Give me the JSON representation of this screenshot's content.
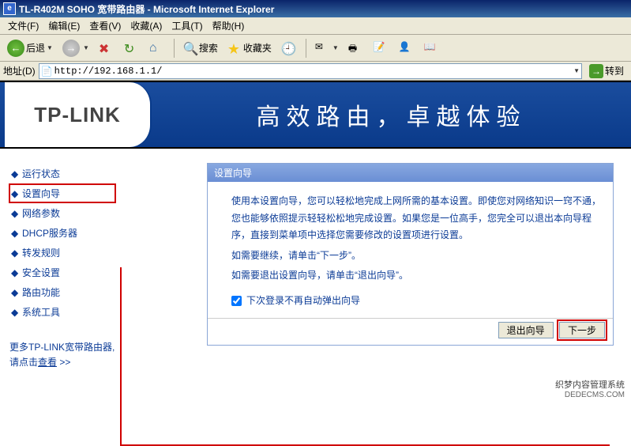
{
  "window": {
    "title": "TL-R402M SOHO 宽带路由器 - Microsoft Internet Explorer"
  },
  "menu": {
    "file": "文件(F)",
    "edit": "编辑(E)",
    "view": "查看(V)",
    "fav": "收藏(A)",
    "tools": "工具(T)",
    "help": "帮助(H)"
  },
  "toolbar": {
    "back": "后退",
    "search": "搜索",
    "favorites": "收藏夹"
  },
  "addr": {
    "label": "地址(D)",
    "url": "http://192.168.1.1/",
    "go": "转到"
  },
  "brand": {
    "logo": "TP-LINK",
    "slogan": "高效路由，卓越体验"
  },
  "sidebar": {
    "items": [
      {
        "label": "运行状态"
      },
      {
        "label": "设置向导"
      },
      {
        "label": "网络参数"
      },
      {
        "label": "DHCP服务器"
      },
      {
        "label": "转发规则"
      },
      {
        "label": "安全设置"
      },
      {
        "label": "路由功能"
      },
      {
        "label": "系统工具"
      }
    ],
    "more_prefix": "更多TP-LINK宽带路由器,请点击",
    "more_link": "查看",
    "more_suffix": " >>"
  },
  "wizard": {
    "title": "设置向导",
    "p1": "使用本设置向导，您可以轻松地完成上网所需的基本设置。即使您对网络知识一窍不通，您也能够依照提示轻轻松松地完成设置。如果您是一位高手，您完全可以退出本向导程序，直接到菜单项中选择您需要修改的设置项进行设置。",
    "p2": "如需要继续，请单击“下一步”。",
    "p3": "如需要退出设置向导，请单击“退出向导”。",
    "cb": "下次登录不再自动弹出向导",
    "exit": "退出向导",
    "next": "下一步"
  },
  "watermark": {
    "zh": "织梦内容管理系统",
    "en": "DEDECMS.COM"
  }
}
